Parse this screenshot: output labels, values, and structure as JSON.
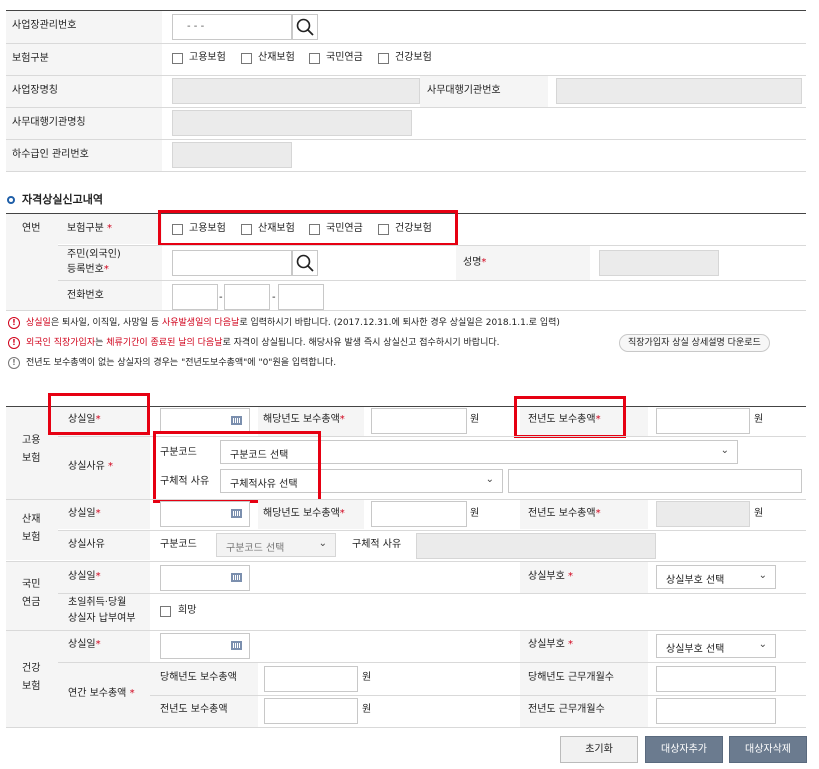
{
  "top": {
    "biz_no_label": "사업장관리번호",
    "biz_no_value": "- -  -",
    "ins_type_label": "보험구분",
    "ins_options": [
      "고용보험",
      "산재보험",
      "국민연금",
      "건강보험"
    ],
    "biz_name_label": "사업장명칭",
    "agency_no_label": "사무대행기관번호",
    "agency_name_label": "사무대행기관명칭",
    "subcontract_label": "하수급인 관리번호"
  },
  "section": {
    "title": "자격상실신고내역",
    "seq_label": "연번",
    "ins_type_label": "보험구분",
    "ins_options": [
      "고용보험",
      "산재보험",
      "국민연금",
      "건강보험"
    ],
    "resident_label_1": "주민(외국인)",
    "resident_label_2": "등록번호",
    "name_label": "성명",
    "phone_label": "전화번호",
    "required_mark": "*"
  },
  "notices": {
    "n1_part1": "상실일",
    "n1_part2": "은 퇴사일, 이직일, 사망일 등 ",
    "n1_part3": "사유발생일의 다음날",
    "n1_part4": "로 입력하시기 바랍니다. (2017.12.31.에 퇴사한 경우 상실일은 2018.1.1.로 입력)",
    "n2_part1": "외국인 직장가입자",
    "n2_part2": "는 ",
    "n2_part3": "체류기간이 종료된 날의 다음날",
    "n2_part4": "로 자격이 상실됩니다. 해당사유 발생 즉시 상실신고 접수하시기 바랍니다.",
    "n2_button": "직장가입자 상실 상세설명 다운로드",
    "n3": "전년도 보수총액이 없는 상실자의 경우는 \"전년도보수총액\"에 \"0\"원을 입력합니다."
  },
  "employment": {
    "group_label_1": "고용",
    "group_label_2": "보험",
    "loss_date_label": "상실일",
    "current_pay_label": "해당년도 보수총액",
    "won": "원",
    "prev_pay_label": "전년도 보수총액",
    "reason_label": "상실사유",
    "category_code_label": "구분코드",
    "category_code_value": "구분코드 선택",
    "detail_reason_label": "구체적 사유",
    "detail_reason_value": "구체적사유 선택"
  },
  "industrial": {
    "group_label_1": "산재",
    "group_label_2": "보험",
    "loss_date_label": "상실일",
    "current_pay_label": "해당년도 보수총액",
    "won": "원",
    "prev_pay_label": "전년도 보수총액",
    "reason_label": "상실사유",
    "category_code_label": "구분코드",
    "category_code_value": "구분코드 선택",
    "detail_reason_label": "구체적 사유"
  },
  "pension": {
    "group_label_1": "국민",
    "group_label_2": "연금",
    "loss_date_label": "상실일",
    "loss_code_label": "상실부호",
    "loss_code_value": "상실부호 선택",
    "first_month_label_1": "초일취득·당월",
    "first_month_label_2": "상실자 납부여부",
    "hope_label": "희망"
  },
  "health": {
    "group_label_1": "건강",
    "group_label_2": "보험",
    "loss_date_label": "상실일",
    "loss_code_label": "상실부호",
    "loss_code_value": "상실부호 선택",
    "annual_pay_label": "연간 보수총액",
    "current_pay_label": "당해년도 보수총액",
    "won": "원",
    "current_months_label": "당해년도 근무개월수",
    "prev_pay_label": "전년도 보수총액",
    "prev_months_label": "전년도 근무개월수"
  },
  "buttons": {
    "reset": "초기화",
    "add": "대상자추가",
    "delete": "대상자삭제"
  }
}
